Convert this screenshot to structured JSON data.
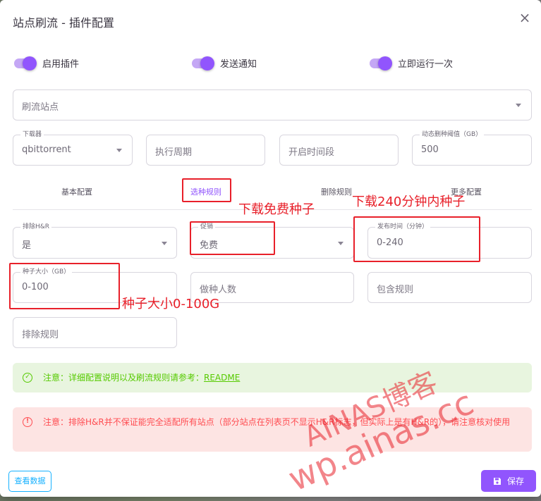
{
  "dialog": {
    "title": "站点刷流 - 插件配置",
    "close_glyph": "×"
  },
  "switches": [
    {
      "label": "启用插件",
      "on": true
    },
    {
      "label": "发送通知",
      "on": true
    },
    {
      "label": "立即运行一次",
      "on": true
    }
  ],
  "site_select": {
    "placeholder": "刷流站点"
  },
  "downloader": {
    "label": "下载器",
    "value": "qbittorrent"
  },
  "cron": {
    "placeholder": "执行周期"
  },
  "time_range": {
    "placeholder": "开启时间段"
  },
  "delete_threshold": {
    "label": "动态删种阈值（GB）",
    "value": "500"
  },
  "tabs": [
    {
      "label": "基本配置",
      "active": false
    },
    {
      "label": "选种规则",
      "active": true
    },
    {
      "label": "删除规则",
      "active": false
    },
    {
      "label": "更多配置",
      "active": false
    }
  ],
  "rules": {
    "hr": {
      "label": "排除H&R",
      "value": "是"
    },
    "promo": {
      "label": "促销",
      "value": "免费"
    },
    "pubtime": {
      "label": "发布时间（分钟）",
      "value": "0-240"
    },
    "size": {
      "label": "种子大小（GB）",
      "value": "0-100"
    },
    "seeders": {
      "placeholder": "做种人数"
    },
    "include": {
      "placeholder": "包含规则"
    },
    "exclude": {
      "placeholder": "排除规则"
    }
  },
  "alerts": {
    "info_text": "注意：详细配置说明以及刷流规则请参考：",
    "info_link": "README",
    "warn_text": "注意：排除H&R并不保证能完全适配所有站点（部分站点在列表页不显示H&R标志，但实际上是有H&R的），请注意核对使用"
  },
  "buttons": {
    "view_data": "查看数据",
    "save": "保存"
  },
  "annotations": {
    "free": "下载免费种子",
    "within": "下载240分钟内种子",
    "size": "种子大小0-100G"
  },
  "watermarks": {
    "line1": "AINAS博客",
    "line2": "wp.ainas.cc"
  },
  "colors": {
    "primary": "#9155fd",
    "success": "#56ca00",
    "error": "#ff4c51",
    "info": "#16b1ff",
    "annotation": "#e8202a"
  }
}
